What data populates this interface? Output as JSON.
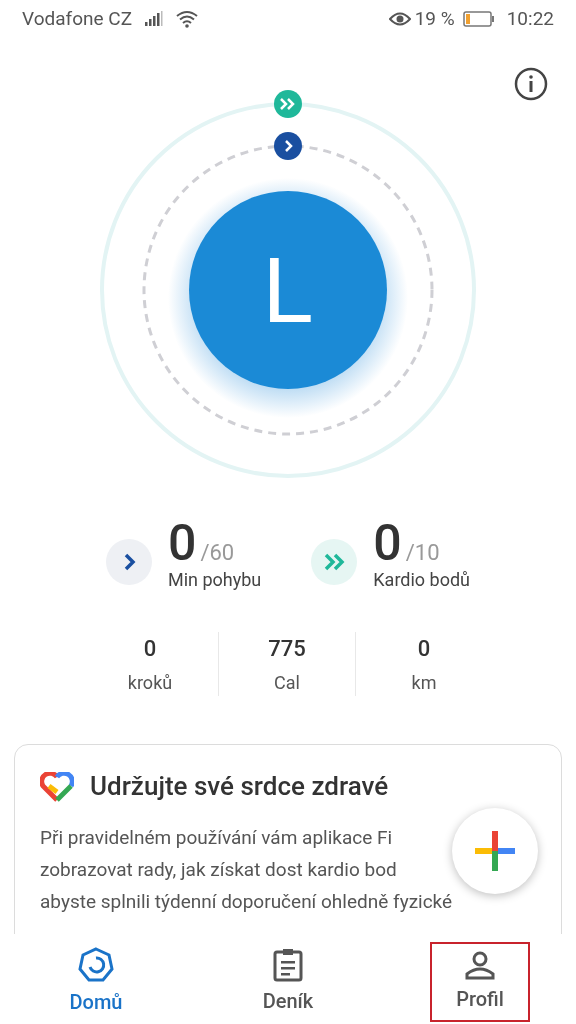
{
  "status_bar": {
    "carrier": "Vodafone CZ",
    "battery_text": "19 %",
    "time": "10:22"
  },
  "avatar": {
    "letter": "L"
  },
  "goals": [
    {
      "kind": "move",
      "value": "0",
      "target": "/60",
      "label": "Min pohybu"
    },
    {
      "kind": "heart",
      "value": "0",
      "target": "/10",
      "label": "Kardio bodů"
    }
  ],
  "stats": [
    {
      "value": "0",
      "label": "kroků"
    },
    {
      "value": "775",
      "label": "Cal"
    },
    {
      "value": "0",
      "label": "km"
    }
  ],
  "card": {
    "title": "Udržujte své srdce zdravé",
    "lines": [
      "Při pravidelném používání vám aplikace Fi",
      "zobrazovat rady, jak získat dost kardio bod",
      "abyste splnili týdenní doporučení ohledně fyzické"
    ]
  },
  "nav": [
    {
      "label": "Domů",
      "selected": true,
      "kind": "home",
      "highlighted": false
    },
    {
      "label": "Deník",
      "selected": false,
      "kind": "journal",
      "highlighted": false
    },
    {
      "label": "Profil",
      "selected": false,
      "kind": "profile",
      "highlighted": true
    }
  ]
}
